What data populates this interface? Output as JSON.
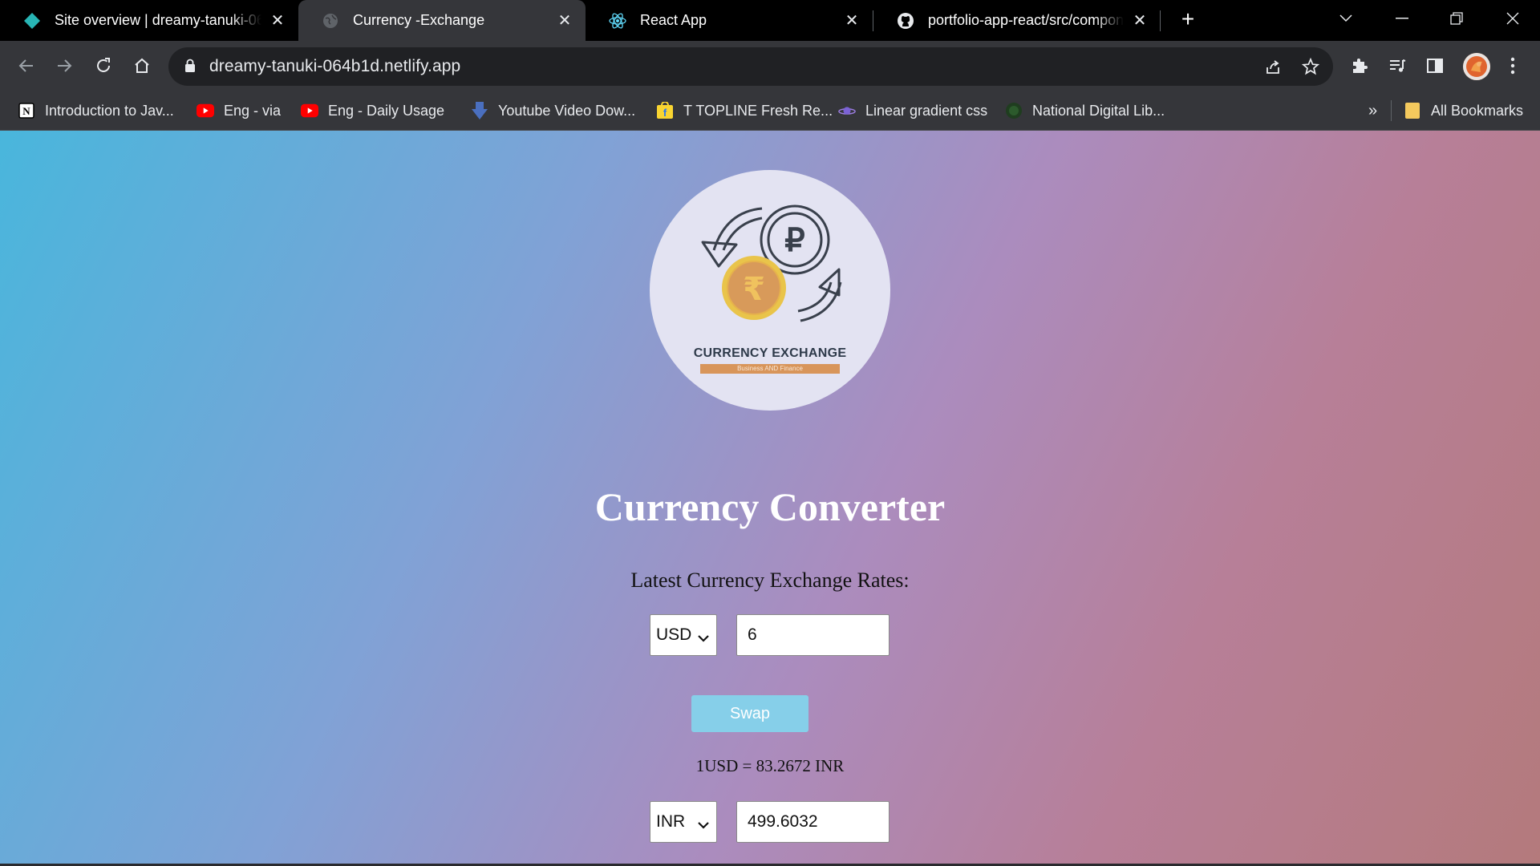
{
  "tabs": [
    {
      "title": "Site overview | dreamy-tanuki-064b1d",
      "favicon": "netlify-diamond-icon",
      "active": false
    },
    {
      "title": "Currency -Exchange",
      "favicon": "globe-icon",
      "active": true
    },
    {
      "title": "React App",
      "favicon": "react-logo-icon",
      "active": false
    },
    {
      "title": "portfolio-app-react/src/components",
      "favicon": "github-icon",
      "active": false
    }
  ],
  "toolbar": {
    "url": "dreamy-tanuki-064b1d.netlify.app"
  },
  "bookmarks": {
    "items": [
      {
        "label": "Introduction to Jav...",
        "icon": "notion-icon"
      },
      {
        "label": "Eng - via",
        "icon": "youtube-icon"
      },
      {
        "label": "Eng -  Daily Usage",
        "icon": "youtube-icon"
      },
      {
        "label": "Youtube Video Dow...",
        "icon": "download-arrow-icon"
      },
      {
        "label": "T TOPLINE Fresh Re...",
        "icon": "flipkart-icon"
      },
      {
        "label": "Linear gradient css",
        "icon": "planet-icon"
      },
      {
        "label": "National Digital Lib...",
        "icon": "library-icon"
      }
    ],
    "overflow": "»",
    "all_bookmarks": "All Bookmarks"
  },
  "page": {
    "logo": {
      "title": "CURRENCY EXCHANGE",
      "subtitle": "Business AND Finance"
    },
    "heading": "Currency Converter",
    "subheading": "Latest Currency Exchange Rates:",
    "from": {
      "currency": "USD",
      "amount": "6"
    },
    "swap_label": "Swap",
    "rate_text": "1USD = 83.2672 INR",
    "to": {
      "currency": "INR",
      "amount": "499.6032"
    }
  },
  "colors": {
    "gradient_start": "#49b6dc",
    "gradient_mid": "#ab8cbe",
    "gradient_end": "#b47a7c",
    "swap_button": "#86cfe9",
    "logo_circle": "#e3e3f2",
    "coin": "#d9a54a"
  }
}
